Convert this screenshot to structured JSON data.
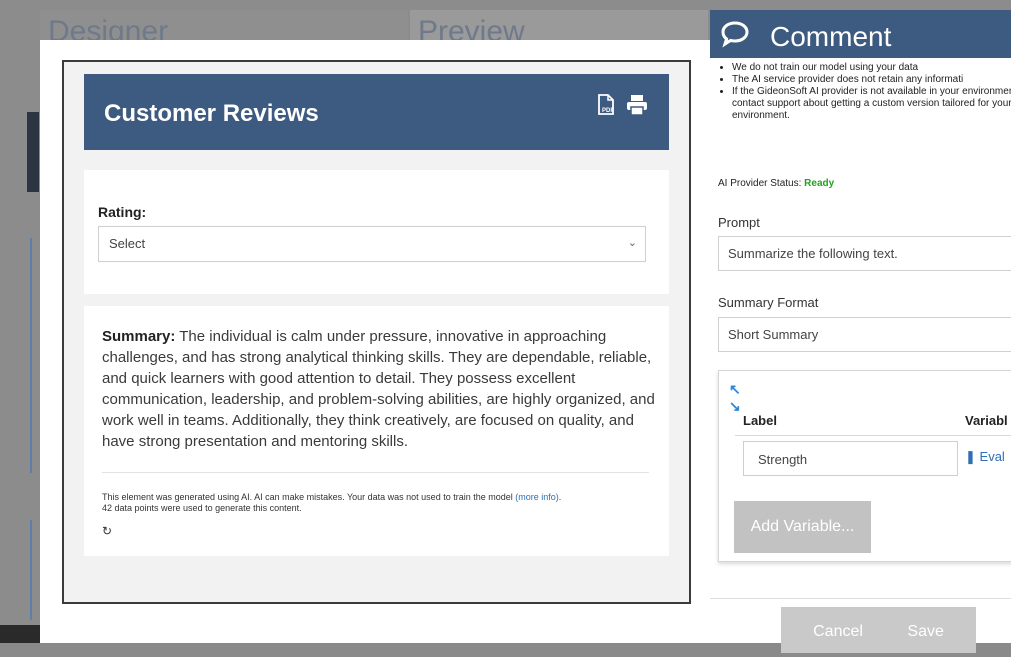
{
  "background": {
    "tabs": [
      "Designer",
      "Preview"
    ]
  },
  "preview": {
    "title": "Customer Reviews",
    "header_icons": [
      "pdf-icon",
      "printer-icon"
    ],
    "rating": {
      "label": "Rating:",
      "selected": "Select"
    },
    "summary": {
      "label": "Summary:",
      "text": "The individual is calm under pressure, innovative in approaching challenges, and has strong analytical thinking skills. They are dependable, reliable, and quick learners with good attention to detail. They possess excellent communication, leadership, and problem-solving abilities, are highly organized, and work well in teams. Additionally, they think creatively, are focused on quality, and have strong presentation and mentoring skills."
    },
    "ai_note": {
      "text": "This element was generated using AI. AI can make mistakes. Your data was not used to train the model ",
      "link": "(more info)",
      "end": ".",
      "points": "42 data points were used to generate this content."
    }
  },
  "comment_panel": {
    "title": "Comment",
    "bullets": [
      "We do not train our model using your data",
      "The AI service provider does not retain any informati",
      "If the GideonSoft AI provider is not available in your environment, contact support about getting a custom version tailored for your environment."
    ],
    "status_label": "AI Provider Status: ",
    "status_value": "Ready",
    "prompt_label": "Prompt",
    "prompt_value": "Summarize the following text.",
    "format_label": "Summary Format",
    "format_value": "Short Summary",
    "variables": {
      "col_label": "Label",
      "col_variable": "Variabl",
      "rows": [
        {
          "label": "Strength",
          "variable": "Eval"
        }
      ],
      "add_button": "Add Variable..."
    },
    "cancel": "Cancel",
    "save": "Save"
  },
  "colors": {
    "header": "#3d5a80",
    "status_ready": "#1fa31f",
    "link": "#2f6fb4"
  }
}
